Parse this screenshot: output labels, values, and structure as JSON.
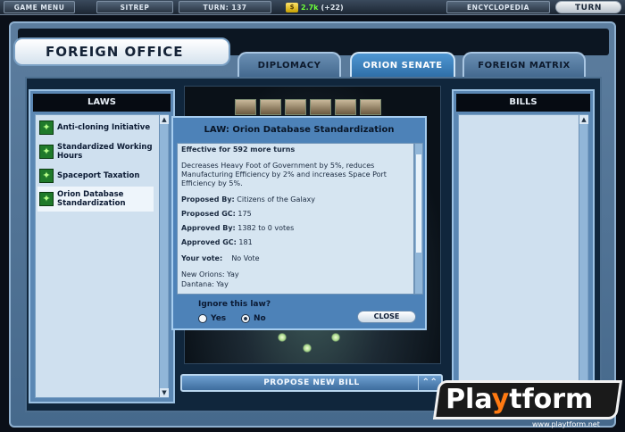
{
  "topbar": {
    "game_menu": "GAME MENU",
    "sitrep": "SITREP",
    "turn_counter": "TURN: 137",
    "money_icon_text": "$",
    "money_value": "2.7k",
    "money_delta": "(+22)",
    "encyclopedia": "ENCYCLOPEDIA",
    "turn_button": "TURN"
  },
  "screen": {
    "title": "FOREIGN OFFICE",
    "tabs": [
      {
        "label": "DIPLOMACY",
        "active": false
      },
      {
        "label": "ORION SENATE",
        "active": true
      },
      {
        "label": "FOREIGN MATRIX",
        "active": false
      }
    ]
  },
  "laws_panel": {
    "header": "LAWS",
    "items": [
      {
        "label": "Anti-cloning Initiative",
        "selected": false
      },
      {
        "label": "Standardized Working Hours",
        "selected": false
      },
      {
        "label": "Spaceport Taxation",
        "selected": false
      },
      {
        "label": "Orion Database Standardization",
        "selected": true
      }
    ]
  },
  "bills_panel": {
    "header": "BILLS"
  },
  "dialog": {
    "title": "LAW:  Orion Database Standardization",
    "effective": "Effective for 592 more turns",
    "description": "Decreases Heavy Foot of Government by 5%, reduces Manufacturing Efficiency by 2% and increases Space Port Efficiency by 5%.",
    "proposed_by_label": "Proposed By:",
    "proposed_by_value": "Citizens of the Galaxy",
    "proposed_gc_label": "Proposed GC:",
    "proposed_gc_value": "175",
    "approved_by_label": "Approved By:",
    "approved_by_value": "1382 to 0 votes",
    "approved_gc_label": "Approved GC:",
    "approved_gc_value": "181",
    "your_vote_label": "Your vote:",
    "your_vote_value": "No Vote",
    "votes_1": "New Orions: Yay",
    "votes_2": "Dantana: Yay",
    "ignore_label": "Ignore this law?",
    "yes_label": "Yes",
    "no_label": "No",
    "selected_option": "No",
    "close_label": "CLOSE"
  },
  "propose_bar": {
    "label": "PROPOSE NEW BILL",
    "arrow": "⌃⌃"
  },
  "watermark": {
    "brand_pre": "Pla",
    "brand_y": "y",
    "brand_post": "tform",
    "url": "www.playtform.net"
  }
}
